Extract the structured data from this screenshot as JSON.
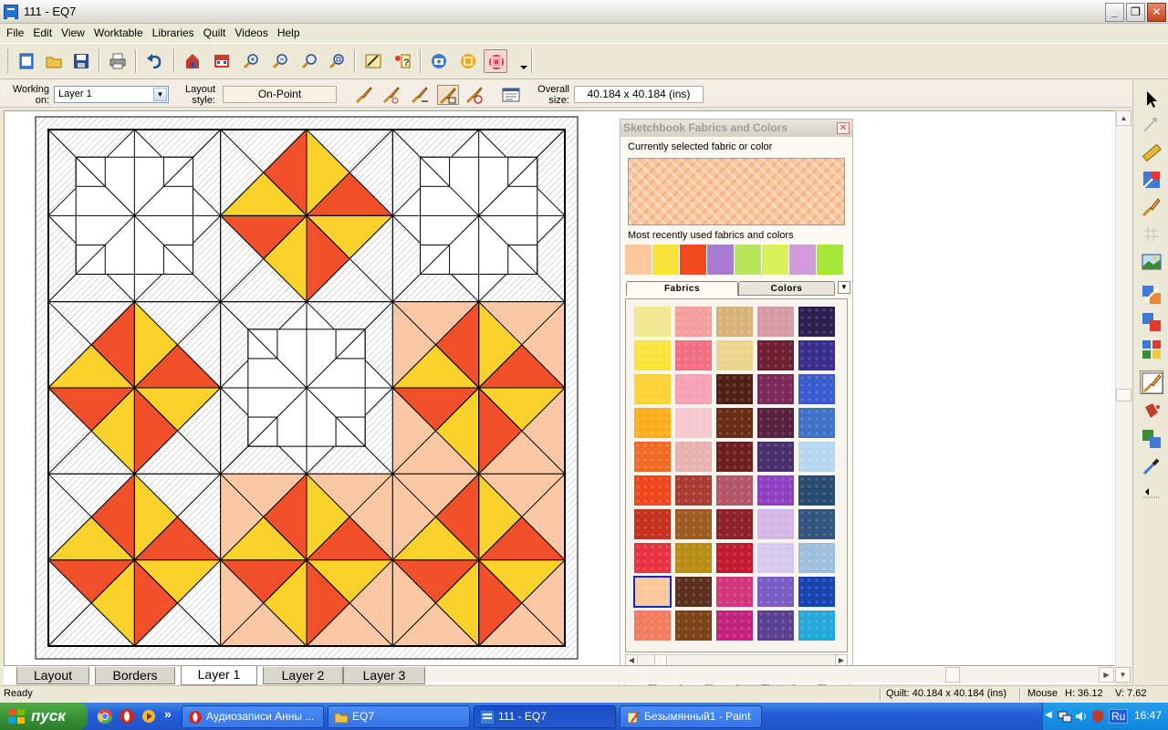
{
  "window": {
    "title": "111 - EQ7",
    "controls": {
      "minimize": "_",
      "restore": "❐",
      "close": "✕"
    }
  },
  "menu": [
    "File",
    "Edit",
    "View",
    "Worktable",
    "Libraries",
    "Quilt",
    "Videos",
    "Help"
  ],
  "toolbar_icons": [
    "new-icon",
    "open-icon",
    "save-icon",
    "print-icon",
    "undo-icon",
    "add-to-sketchbook-icon",
    "view-sketchbook-icon",
    "zoom-in-icon",
    "zoom-out-icon",
    "refresh-icon",
    "fit-to-worktable-icon",
    "notecard-icon",
    "help-icon",
    "camera-icon",
    "print-preview-icon",
    "fabric-worktable-icon"
  ],
  "layout_bar": {
    "working_on_label": "Working on:",
    "layer_value": "Layer 1",
    "layout_style_label": "Layout style:",
    "layout_style_value": "On-Point",
    "overall_size_label": "Overall size:",
    "overall_size_value": "40.184 x 40.184 (ins)"
  },
  "tabs": [
    {
      "label": "Layout",
      "active": false
    },
    {
      "label": "Borders",
      "active": false
    },
    {
      "label": "Layer 1",
      "active": true
    },
    {
      "label": "Layer 2",
      "active": false
    },
    {
      "label": "Layer 3",
      "active": false
    }
  ],
  "status": {
    "ready": "Ready",
    "quilt": "Quilt: 40.184 x 40.184 (ins)",
    "mouse_label": "Mouse",
    "mouse_h": "H: 36.12",
    "mouse_v": "V: 7.62"
  },
  "sketchbook": {
    "title": "Sketchbook Fabrics and Colors",
    "current_label": "Currently selected fabric or color",
    "recent_label": "Most recently used fabrics and colors",
    "tab_fabrics": "Fabrics",
    "tab_colors": "Colors",
    "recent": [
      "#fbc79d",
      "#f7e33a",
      "#ee4a20",
      "#a77bd0",
      "#b8e65a",
      "#d8f15a",
      "#d19ad9",
      "#a6e73a"
    ],
    "swatches": [
      "#f3e790",
      "#f39fa0",
      "#d7b17a",
      "#d69aa6",
      "#2a2052",
      "#fbe33d",
      "#f36f84",
      "#ecd38e",
      "#6e1f33",
      "#3a2d8d",
      "#fdd235",
      "#f6a2b6",
      "#4e2016",
      "#7b2a5a",
      "#3a5ccf",
      "#fdae1e",
      "#f6c8d1",
      "#6a2d16",
      "#56213f",
      "#3e72c6",
      "#ef6a23",
      "#e7b3b1",
      "#6e1e1c",
      "#4a2f6e",
      "#b7d7f1",
      "#f0461f",
      "#a93b33",
      "#b45569",
      "#8d41c0",
      "#284a6e",
      "#c4301c",
      "#9b5c22",
      "#8d2028",
      "#d4b8e6",
      "#33557d",
      "#e83241",
      "#b78d15",
      "#c31931",
      "#d7c8ee",
      "#9dbfdc",
      "#fbc79d",
      "#5a2f1e",
      "#d2367b",
      "#7b5cc4",
      "#1742b0",
      "#f27c5d",
      "#7c4418",
      "#c2237c",
      "#5a4090",
      "#25a7d9"
    ],
    "selected_swatch_index": 40,
    "view_buttons": [
      "▦",
      "▦",
      "▦",
      "▦"
    ]
  },
  "taskbar": {
    "start": "пуск",
    "quick_more": "»",
    "tasks": [
      {
        "label": "Аудиозаписи Анны ...",
        "active": false
      },
      {
        "label": "EQ7",
        "active": false
      },
      {
        "label": "111 - EQ7",
        "active": true
      },
      {
        "label": "Безымянный1 - Paint",
        "active": false
      }
    ],
    "lang": "Ru",
    "time": "16:47"
  },
  "colors": {
    "yellow": "#fbd22c",
    "orange": "#f2502a",
    "peach": "#fbc8a6",
    "line": "#000000",
    "hatch": "#7a7a7a"
  }
}
